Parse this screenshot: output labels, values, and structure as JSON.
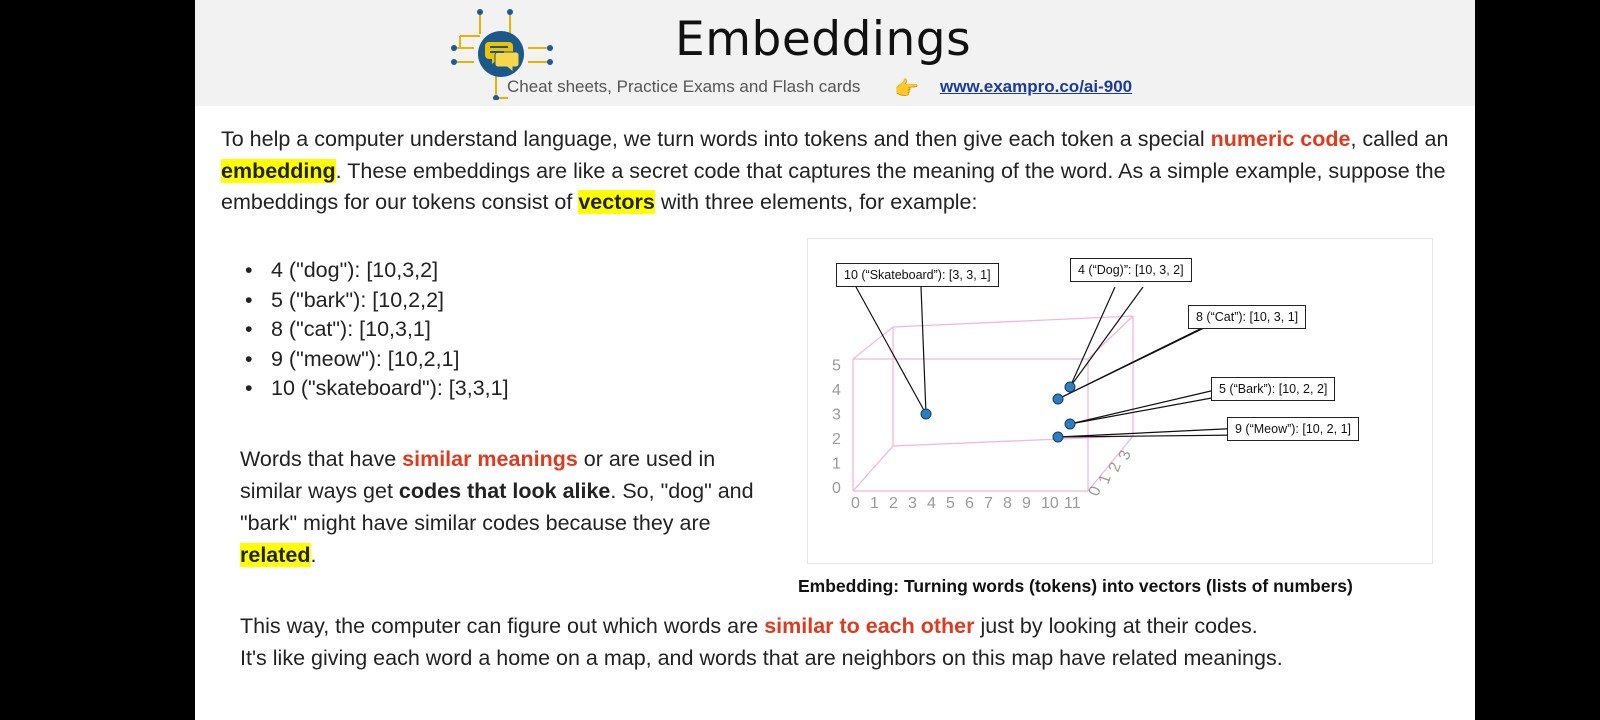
{
  "header": {
    "title": "Embeddings",
    "subtitle": "Cheat sheets, Practice Exams and Flash cards",
    "link": "www.exampro.co/ai-900",
    "hand_glyph": "👉"
  },
  "intro": {
    "p1": "To help a computer understand language, we turn words into tokens and then give each token a special ",
    "numeric_code": "numeric code",
    "p2": ", called an ",
    "embedding": "embedding",
    "p3": ". These embeddings are like a secret code that captures the meaning of the word. As a simple example, suppose the embeddings for our tokens consist of ",
    "vectors": "vectors",
    "p4": " with three elements, for example:"
  },
  "tokens": [
    "4 (\"dog\"): [10,3,2]",
    "5 (\"bark\"): [10,2,2]",
    "8 (\"cat\"): [10,3,1]",
    "9 (\"meow\"): [10,2,1]",
    "10 (\"skateboard\"): [3,3,1]"
  ],
  "similar": {
    "s1": "Words that have ",
    "similar_meanings": "similar meanings",
    "s2": " or are used in similar ways get ",
    "codes_alike": "codes that look alike",
    "s3": ". So, \"dog\" and \"bark\" might have similar codes because they are ",
    "related": "related",
    "s4": "."
  },
  "figure": {
    "callouts": {
      "skateboard": "10 (“Skateboard”): [3, 3, 1]",
      "dog": "4 (“Dog)”: [10, 3, 2]",
      "cat": "8 (“Cat”): [10, 3, 1]",
      "bark": "5 (“Bark”): [10, 2, 2]",
      "meow": "9 (“Meow”): [10, 2, 1]"
    },
    "x_ticks": [
      "0",
      "1",
      "2",
      "3",
      "4",
      "5",
      "6",
      "7",
      "8",
      "9",
      "10",
      "11"
    ],
    "y_ticks": [
      "0",
      "1",
      "2",
      "3",
      "4",
      "5"
    ],
    "z_ticks": [
      "0",
      "1",
      "2",
      "3"
    ],
    "axis_color": "#f1b8dc",
    "point_color": "#2a7fc1"
  },
  "caption": "Embedding: Turning words (tokens) into vectors (lists of numbers)",
  "closing": {
    "c1": "This way, the computer can figure out which words are ",
    "similar_each_other": "similar to each other",
    "c2": " just by looking at their codes.",
    "c3": "It's like giving each word a home on a map, and words that are neighbors on this map have related meanings."
  }
}
